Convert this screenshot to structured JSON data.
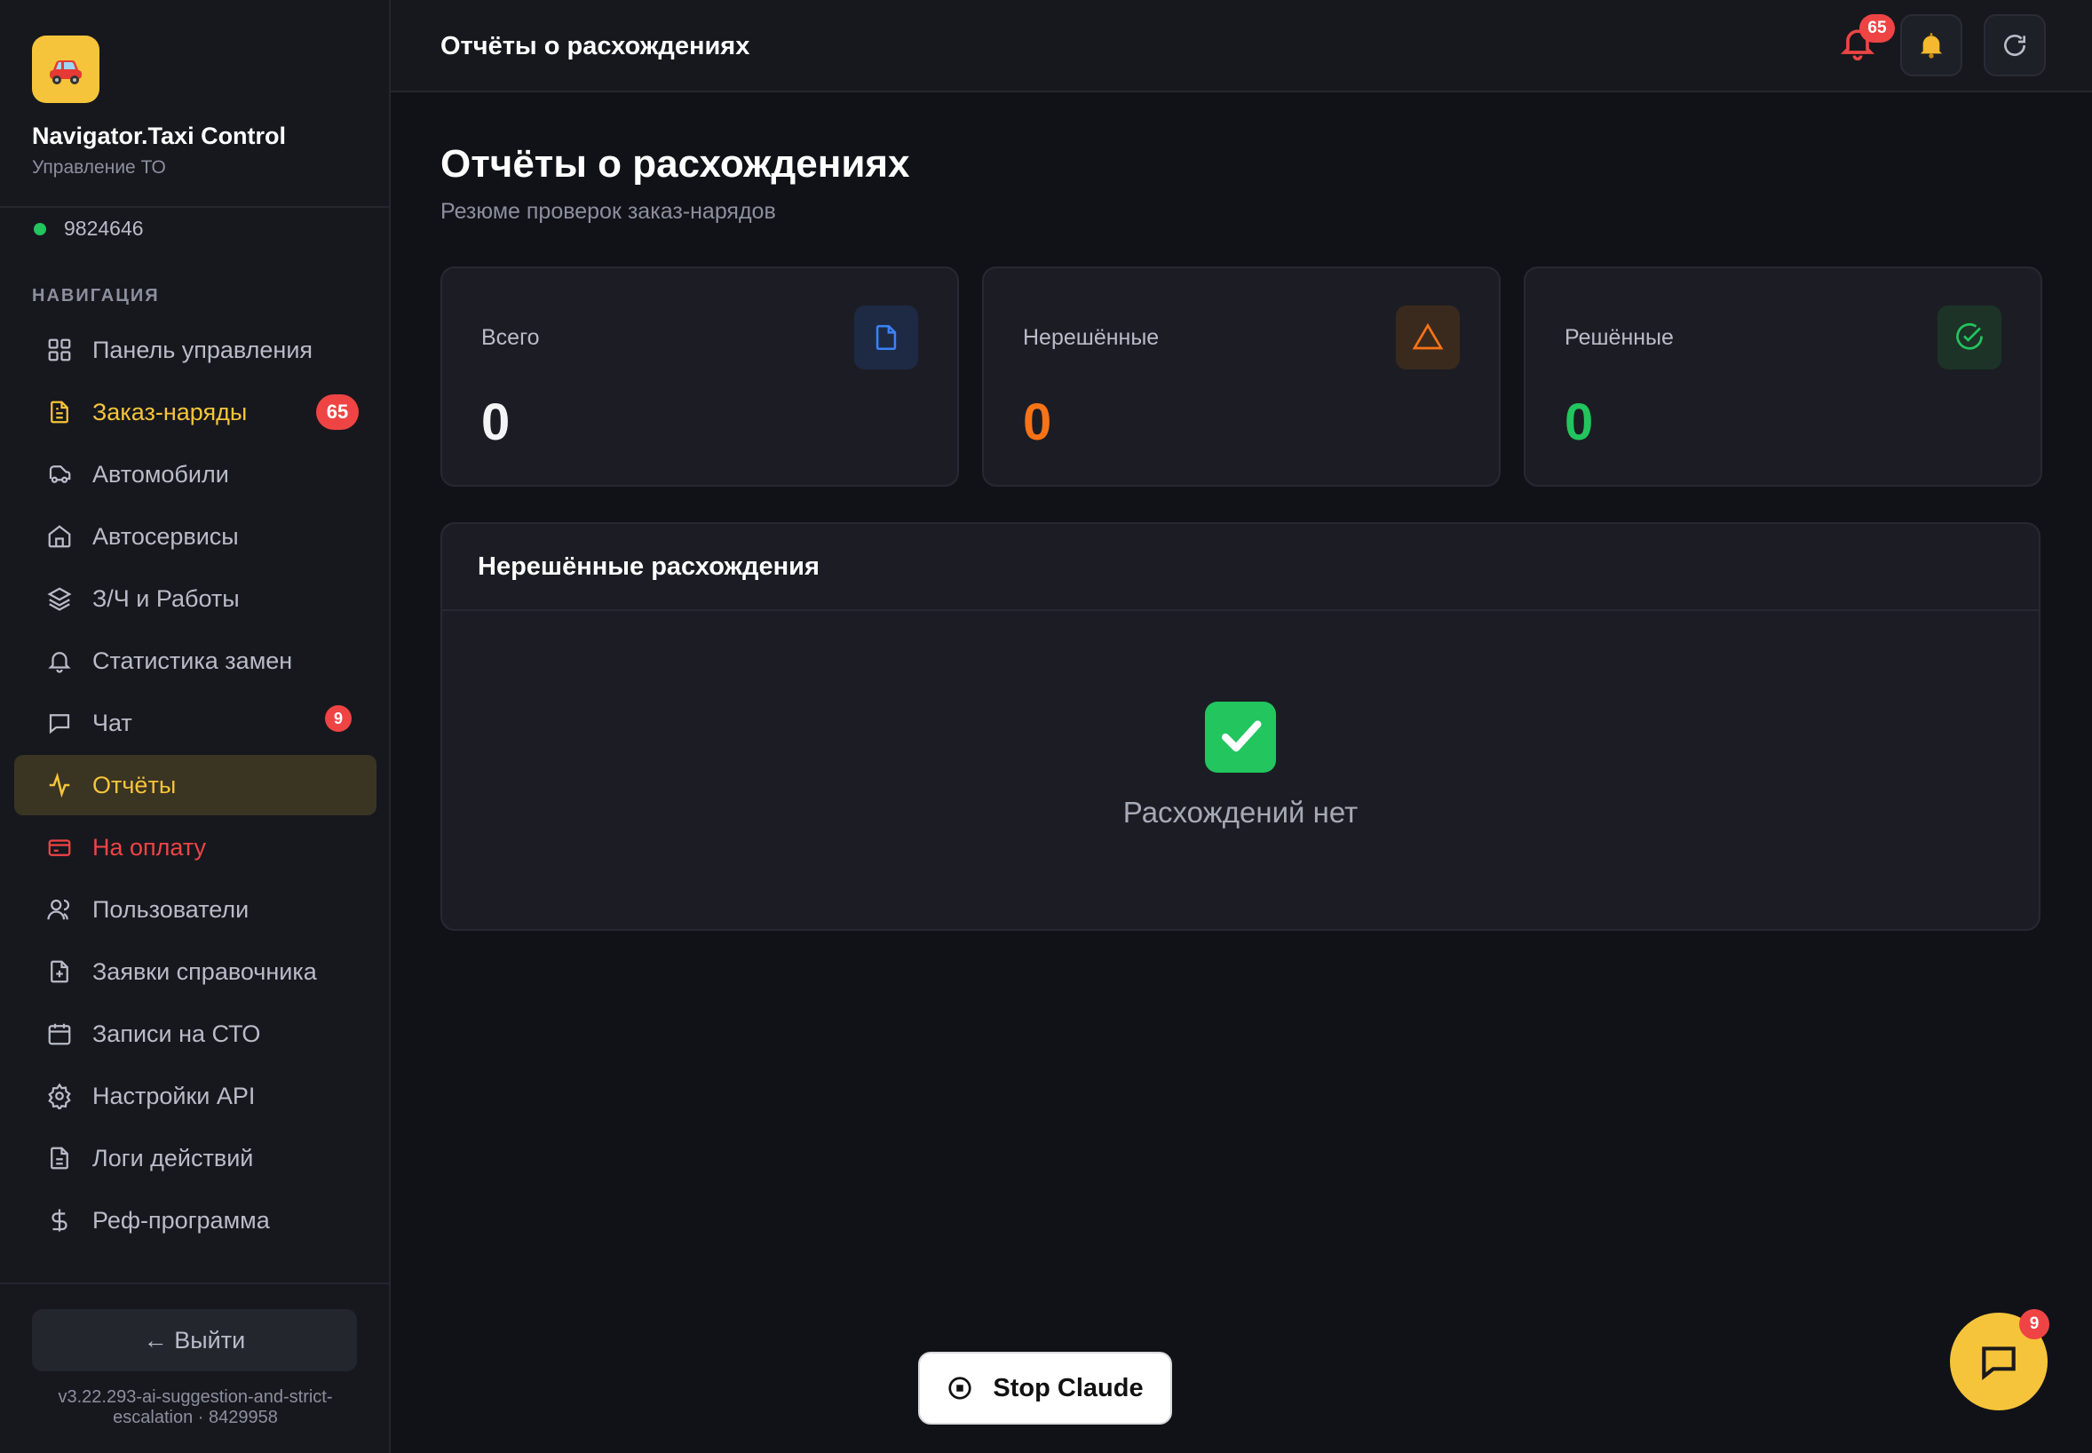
{
  "brand": {
    "title": "Navigator.Taxi Control",
    "subtitle": "Управление ТО",
    "logo_icon": "car-emoji"
  },
  "user": {
    "id": "9824646",
    "status_color": "#22c55e"
  },
  "nav": {
    "heading": "НАВИГАЦИЯ",
    "items": [
      {
        "label": "Панель управления",
        "icon": "grid-icon"
      },
      {
        "label": "Заказ-наряды",
        "icon": "document-icon",
        "badge": "65",
        "state": "highlight"
      },
      {
        "label": "Автомобили",
        "icon": "car-icon"
      },
      {
        "label": "Автосервисы",
        "icon": "building-icon"
      },
      {
        "label": "З/Ч и Работы",
        "icon": "layers-icon"
      },
      {
        "label": "Статистика замен",
        "icon": "bell-icon"
      },
      {
        "label": "Чат",
        "icon": "chat-icon",
        "badge": "9"
      },
      {
        "label": "Отчёты",
        "icon": "activity-icon",
        "state": "active"
      },
      {
        "label": "На оплату",
        "icon": "credit-card-icon",
        "state": "danger"
      },
      {
        "label": "Пользователи",
        "icon": "users-icon"
      },
      {
        "label": "Заявки справочника",
        "icon": "file-plus-icon"
      },
      {
        "label": "Записи на СТО",
        "icon": "calendar-icon"
      },
      {
        "label": "Настройки API",
        "icon": "gear-icon"
      },
      {
        "label": "Логи действий",
        "icon": "file-text-icon"
      },
      {
        "label": "Реф-программа",
        "icon": "dollar-icon"
      }
    ]
  },
  "footer": {
    "logout_label": "← Выйти",
    "version": "v3.22.293-ai-suggestion-and-strict-escalation · 8429958"
  },
  "topbar": {
    "title": "Отчёты о расхождениях",
    "notification_count": "65"
  },
  "page": {
    "title": "Отчёты о расхождениях",
    "subtitle": "Резюме проверок заказ-нарядов"
  },
  "stats": [
    {
      "label": "Всего",
      "value": "0",
      "icon": "file-icon",
      "value_color": "#f3f4f6",
      "icon_color": "#3b82f6",
      "icon_bg": "#1e2a44"
    },
    {
      "label": "Нерешённые",
      "value": "0",
      "icon": "warning-icon",
      "value_color": "#f97316",
      "icon_color": "#f97316",
      "icon_bg": "#3a2a1e"
    },
    {
      "label": "Решённые",
      "value": "0",
      "icon": "check-circle-icon",
      "value_color": "#22c55e",
      "icon_color": "#22c55e",
      "icon_bg": "#1d3327"
    }
  ],
  "panel": {
    "title": "Нерешённые расхождения",
    "empty_icon": "check-mark-emoji",
    "empty_text": "Расхождений нет"
  },
  "stop_button": {
    "label": "Stop Claude"
  },
  "chat_fab": {
    "badge": "9"
  },
  "colors": {
    "accent": "#f5c43a",
    "danger": "#ef4444",
    "success": "#22c55e",
    "warning": "#f97316",
    "info": "#3b82f6"
  }
}
